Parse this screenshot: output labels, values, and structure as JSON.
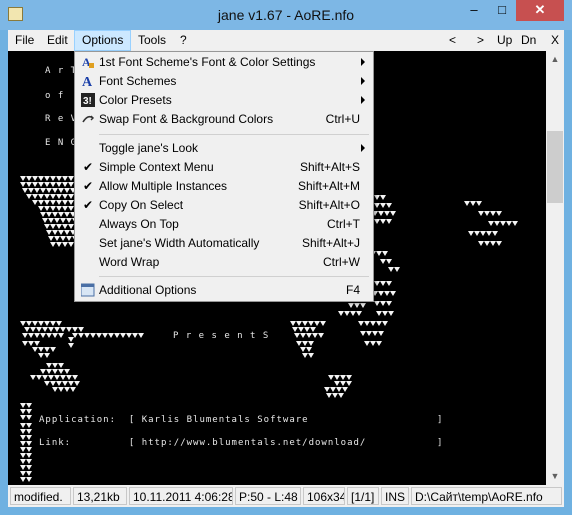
{
  "window": {
    "title": "jane v1.67 - AoRE.nfo",
    "min_symbol": "–",
    "max_symbol": "□",
    "close_symbol": "✕"
  },
  "menubar": {
    "items": [
      "File",
      "Edit",
      "Options",
      "Tools",
      "?"
    ],
    "nav": [
      "<",
      ">",
      "Up",
      "Dn",
      "X"
    ]
  },
  "terminal": {
    "lines": [
      "A r T",
      "o f",
      "R e V",
      "E N G",
      "P r e s e n t S",
      "Application:  [ Karlis Blumentals Software                    ]",
      "Link:         [ http://www.blumentals.net/download/           ]"
    ]
  },
  "options_menu": {
    "items": [
      {
        "label": "1st Font Scheme's Font & Color Settings",
        "shortcut": "",
        "submenu": true,
        "icon": "font-color-icon",
        "check": false
      },
      {
        "label": "Font Schemes",
        "shortcut": "",
        "submenu": true,
        "icon": "font-icon",
        "check": false
      },
      {
        "label": "Color Presets",
        "shortcut": "",
        "submenu": true,
        "icon": "palette-icon",
        "check": false
      },
      {
        "label": "Swap Font & Background Colors",
        "shortcut": "Ctrl+U",
        "submenu": false,
        "icon": "swap-icon",
        "check": false
      },
      {
        "label": "Toggle jane's Look",
        "shortcut": "",
        "submenu": true,
        "icon": "",
        "check": false
      },
      {
        "label": "Simple Context Menu",
        "shortcut": "Shift+Alt+S",
        "submenu": false,
        "icon": "",
        "check": true
      },
      {
        "label": "Allow Multiple Instances",
        "shortcut": "Shift+Alt+M",
        "submenu": false,
        "icon": "",
        "check": true
      },
      {
        "label": "Copy On Select",
        "shortcut": "Shift+Alt+O",
        "submenu": false,
        "icon": "",
        "check": true
      },
      {
        "label": "Always On Top",
        "shortcut": "Ctrl+T",
        "submenu": false,
        "icon": "",
        "check": false
      },
      {
        "label": "Set jane's Width Automatically",
        "shortcut": "Shift+Alt+J",
        "submenu": false,
        "icon": "",
        "check": false
      },
      {
        "label": "Word Wrap",
        "shortcut": "Ctrl+W",
        "submenu": false,
        "icon": "",
        "check": false
      },
      {
        "label": "Additional Options",
        "shortcut": "F4",
        "submenu": false,
        "icon": "options-icon",
        "check": false
      }
    ]
  },
  "statusbar": {
    "cells": [
      "modified.",
      "13,21kb",
      "10.11.2011 4:06:28",
      "P:50 - L:48",
      "106x34",
      "[1/1]",
      "INS",
      "D:\\Сайт\\temp\\AoRE.nfo"
    ]
  },
  "colors": {
    "title_bg": "#7db7e5",
    "terminal_bg": "#000000",
    "close_bg": "#c75050",
    "menu_highlight": "#cce8ff"
  }
}
